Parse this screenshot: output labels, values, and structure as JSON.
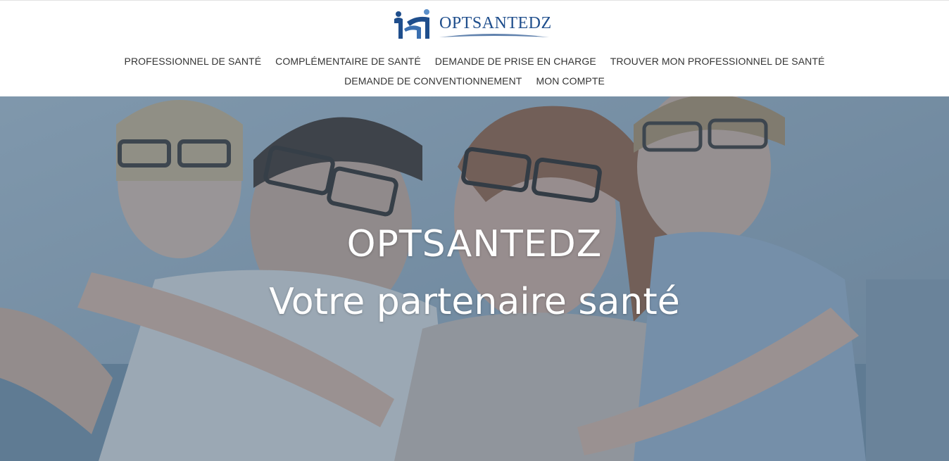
{
  "brand": {
    "name": "OPTSANTEDZ",
    "color": "#1f4e8c",
    "icon": "family-logo-icon"
  },
  "nav": {
    "row1": [
      {
        "label": "PROFESSIONNEL DE SANTÉ"
      },
      {
        "label": "COMPLÉMENTAIRE DE SANTÉ"
      },
      {
        "label": "DEMANDE DE PRISE EN CHARGE"
      },
      {
        "label": "TROUVER MON PROFESSIONNEL DE SANTÉ"
      }
    ],
    "row2": [
      {
        "label": "DEMANDE DE CONVENTIONNEMENT"
      },
      {
        "label": "MON COMPTE"
      }
    ]
  },
  "hero": {
    "title": "OPTSANTEDZ",
    "subtitle": "Votre partenaire santé",
    "overlay_color": "#465f78"
  }
}
